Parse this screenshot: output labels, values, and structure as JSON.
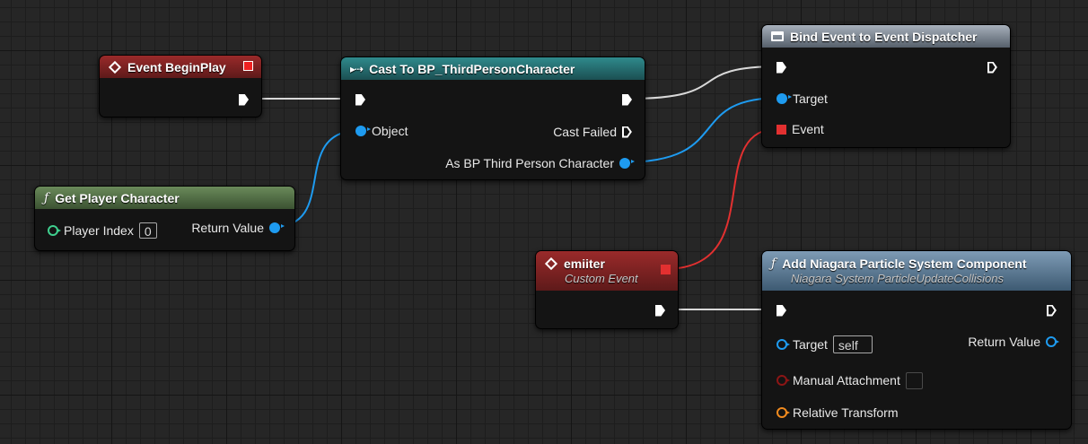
{
  "nodes": {
    "begin_play": {
      "title": "Event BeginPlay"
    },
    "cast": {
      "title": "Cast To BP_ThirdPersonCharacter",
      "object_label": "Object",
      "cast_failed_label": "Cast Failed",
      "as_label": "As BP Third Person Character"
    },
    "bind": {
      "title": "Bind Event to Event Dispatcher",
      "target_label": "Target",
      "event_label": "Event"
    },
    "get_player": {
      "title": "Get Player Character",
      "player_index_label": "Player Index",
      "player_index_value": "0",
      "return_label": "Return Value"
    },
    "custom_event": {
      "title": "emiiter",
      "subtitle": "Custom Event"
    },
    "niagara": {
      "title": "Add Niagara Particle System Component",
      "subtitle": "Niagara System ParticleUpdateCollisions",
      "target_label": "Target",
      "target_value": "self",
      "return_label": "Return Value",
      "manual_attachment_label": "Manual Attachment",
      "relative_transform_label": "Relative Transform"
    }
  },
  "icons": {
    "event": "diamond-event-icon",
    "function": "function-f-icon",
    "cast": "cast-arrow-icon",
    "dispatcher": "dispatcher-window-icon"
  },
  "colors": {
    "exec": "#ffffff",
    "object": "#1e9bf0",
    "delegate": "#e23030",
    "integer": "#3fcf8e",
    "bool": "#8c1515",
    "struct": "#f08a1e"
  }
}
